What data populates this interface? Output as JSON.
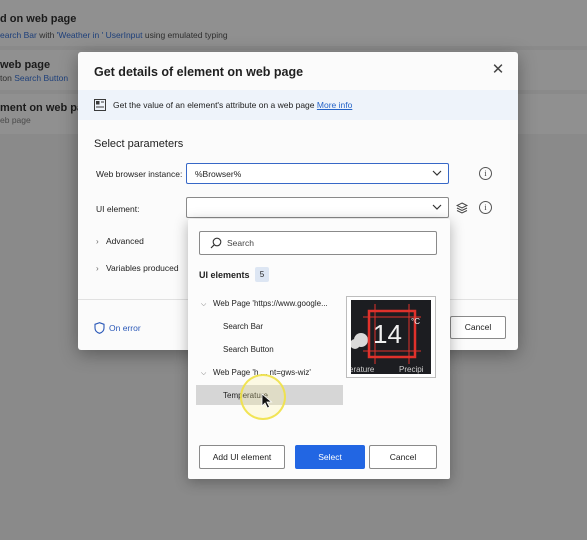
{
  "background": {
    "cards": [
      {
        "title": "d on web page",
        "subtitle_parts": [
          "earch Bar",
          " with ",
          "'Weather in '",
          " ",
          "UserInput",
          "  using emulated typing"
        ]
      },
      {
        "title": "web page",
        "subtitle_parts": [
          "ton ",
          "Search Button"
        ]
      },
      {
        "title": "ment on web pag",
        "subtitle_parts": [
          "eb page"
        ]
      }
    ]
  },
  "dialog": {
    "title": "Get details of element on web page",
    "info_text": "Get the value of an element's attribute on a web page",
    "info_link": "More info",
    "section_title": "Select parameters",
    "web_browser_label": "Web browser instance:",
    "web_browser_value": "%Browser%",
    "ui_element_label": "UI element:",
    "ui_element_value": "",
    "advanced_label": "Advanced",
    "variables_label": "Variables produced",
    "on_error": "On error",
    "cancel": "Cancel"
  },
  "picker": {
    "search_placeholder": "Search",
    "heading": "UI elements",
    "count": "5",
    "tree": [
      {
        "label": "Web Page 'https://www.google...",
        "group": true
      },
      {
        "label": "Search Bar",
        "group": false
      },
      {
        "label": "Search Button",
        "group": false
      },
      {
        "label": "Web Page 'h ... nt=gws-wiz'",
        "group": true
      },
      {
        "label": "Temperature",
        "group": false,
        "selected": true
      }
    ],
    "preview": {
      "value": "14",
      "unit": "°C",
      "caption_left": "erature",
      "caption_right": "Precipi"
    },
    "add_button": "Add UI element",
    "select_button": "Select",
    "cancel_button": "Cancel"
  },
  "colors": {
    "accent": "#2266e3",
    "link": "#2563c7",
    "preview_box": "#e0312b"
  }
}
